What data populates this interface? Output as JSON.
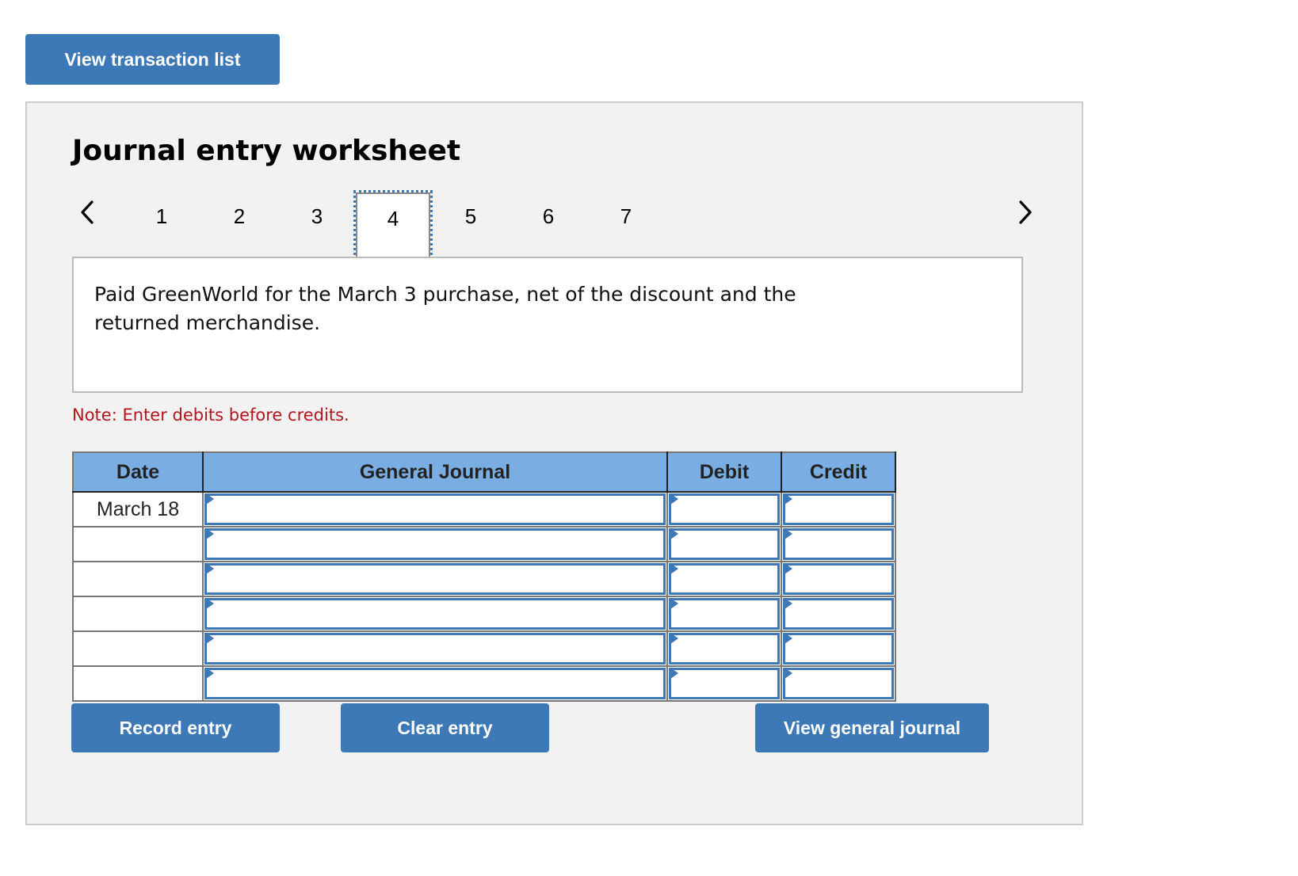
{
  "top_button": {
    "label": "View transaction list"
  },
  "worksheet": {
    "title": "Journal entry worksheet",
    "pages": [
      "1",
      "2",
      "3",
      "4",
      "5",
      "6",
      "7"
    ],
    "active_page": "4",
    "description": "Paid GreenWorld for the March 3 purchase, net of the discount and the returned merchandise.",
    "note": "Note: Enter debits before credits.",
    "table": {
      "headers": {
        "date": "Date",
        "general_journal": "General Journal",
        "debit": "Debit",
        "credit": "Credit"
      },
      "rows": [
        {
          "date": "March 18",
          "account": "",
          "debit": "",
          "credit": ""
        },
        {
          "date": "",
          "account": "",
          "debit": "",
          "credit": ""
        },
        {
          "date": "",
          "account": "",
          "debit": "",
          "credit": ""
        },
        {
          "date": "",
          "account": "",
          "debit": "",
          "credit": ""
        },
        {
          "date": "",
          "account": "",
          "debit": "",
          "credit": ""
        },
        {
          "date": "",
          "account": "",
          "debit": "",
          "credit": ""
        }
      ]
    },
    "buttons": {
      "record": "Record entry",
      "clear": "Clear entry",
      "view_journal": "View general journal"
    }
  },
  "icons": {
    "prev": "chevron-left-icon",
    "next": "chevron-right-icon",
    "row_flag": "triangle-right-icon"
  },
  "colors": {
    "accent": "#3d78b7",
    "header_bg": "#7aade2",
    "note": "#b3151d",
    "panel_bg": "#f2f2f2"
  }
}
